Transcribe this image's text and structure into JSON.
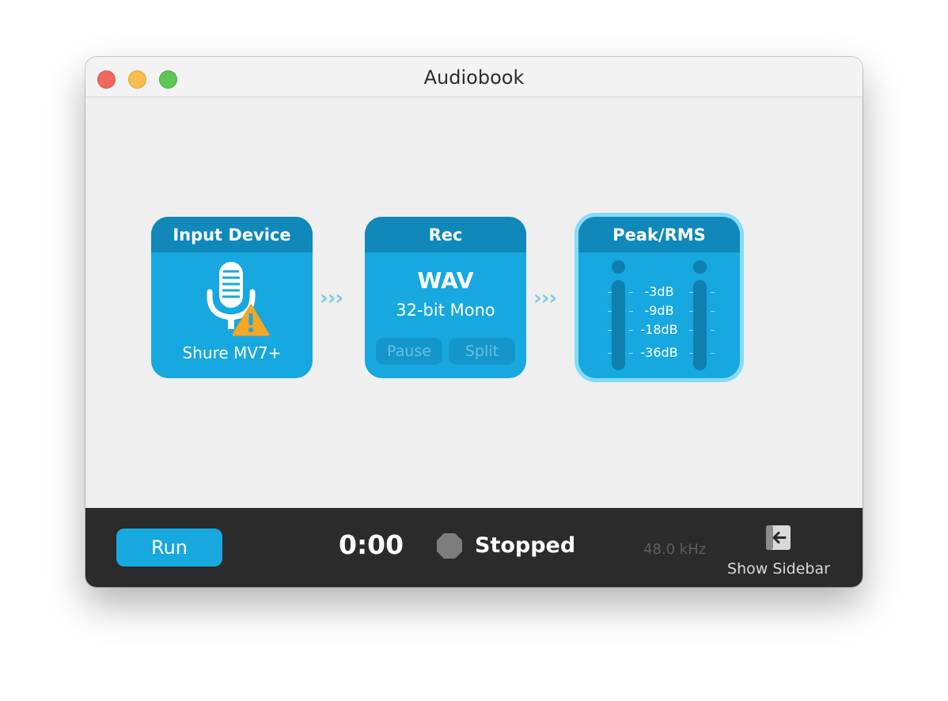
{
  "window": {
    "title": "Audiobook"
  },
  "nodes": {
    "input": {
      "header": "Input Device",
      "device": "Shure MV7+",
      "icon": "microphone-warning-icon"
    },
    "rec": {
      "header": "Rec",
      "format": "WAV",
      "detail": "32-bit Mono",
      "pause_label": "Pause",
      "split_label": "Split"
    },
    "peak": {
      "header": "Peak/RMS",
      "levels": [
        "-3dB",
        "-9dB",
        "-18dB",
        "-36dB"
      ]
    },
    "connector": "›››"
  },
  "toolbar": {
    "run_label": "Run",
    "time": "0:00",
    "status": "Stopped",
    "sample_rate": "48.0 kHz",
    "sidebar_label": "Show Sidebar"
  },
  "colors": {
    "node_body": "#16a8df",
    "node_header": "#1088ba",
    "accent": "#17a8df",
    "highlight": "#84dcf5",
    "toolbar_bg": "#2b2b2b"
  }
}
